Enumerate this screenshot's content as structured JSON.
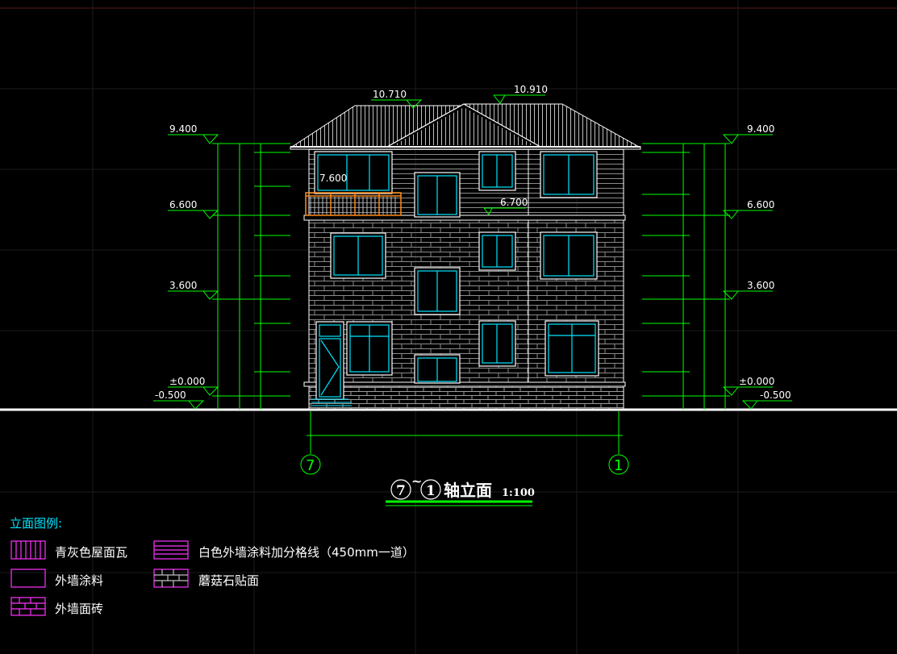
{
  "drawing": {
    "elevations_left": [
      "9.400",
      "6.600",
      "3.600",
      "±0.000",
      "-0.500"
    ],
    "elevations_right": [
      "9.400",
      "6.600",
      "3.600",
      "±0.000",
      "-0.500"
    ],
    "ridge_left": "10.710",
    "ridge_right": "10.910",
    "balcony_level": "7.600",
    "roof_level": "6.700",
    "axis_left": "7",
    "axis_right": "1",
    "title_axis_a": "7",
    "title_tilde": "~",
    "title_axis_b": "1",
    "title_text": "轴立面",
    "scale": "1:100"
  },
  "legend": {
    "heading": "立面图例:",
    "items": [
      {
        "label": "青灰色屋面瓦",
        "pattern": "roof-tile"
      },
      {
        "label": "白色外墙涂料加分格线（450mm一道）",
        "pattern": "horizontal-lines"
      },
      {
        "label": "外墙涂料",
        "pattern": "blank"
      },
      {
        "label": "蘑菇石贴面",
        "pattern": "mushroom-stone"
      },
      {
        "label": "外墙面砖",
        "pattern": "brick"
      }
    ]
  },
  "colors": {
    "background": "#000000",
    "dimension_lines": "#00ff00",
    "outline": "#ffffff",
    "window_frames": "#00e5ff",
    "railing": "#ff8c1a",
    "legend_swatch": "#ff33ff",
    "grid": "#1c1c1c"
  }
}
